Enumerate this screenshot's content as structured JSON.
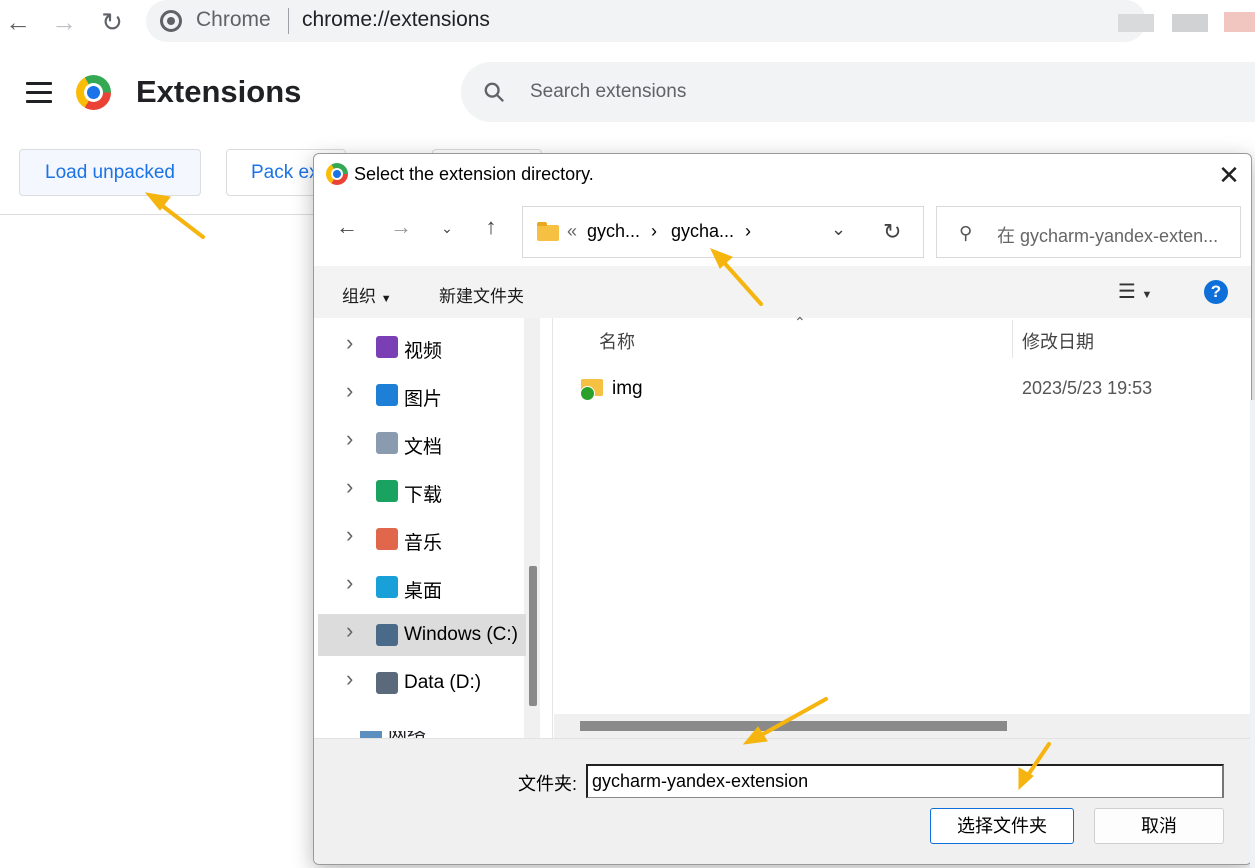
{
  "browser": {
    "site_label": "Chrome",
    "url": "chrome://extensions"
  },
  "page": {
    "title": "Extensions",
    "search_placeholder": "Search extensions",
    "load_unpacked": "Load unpacked",
    "pack_extension": "Pack ex"
  },
  "dialog": {
    "title": "Select the extension directory.",
    "breadcrumb": [
      "gych...",
      "gycha..."
    ],
    "search_placeholder": "在 gycharm-yandex-exten...",
    "toolbar": {
      "organize": "组织",
      "new_folder": "新建文件夹"
    },
    "nav_items": [
      {
        "label": "视频",
        "icon": "video-icon",
        "color": "#7b3fb5"
      },
      {
        "label": "图片",
        "icon": "pictures-icon",
        "color": "#1e7fd6"
      },
      {
        "label": "文档",
        "icon": "documents-icon",
        "color": "#8a9bb0"
      },
      {
        "label": "下载",
        "icon": "downloads-icon",
        "color": "#1aa260"
      },
      {
        "label": "音乐",
        "icon": "music-icon",
        "color": "#e0664c"
      },
      {
        "label": "桌面",
        "icon": "desktop-icon",
        "color": "#1aa0d8"
      },
      {
        "label": "Windows (C:)",
        "icon": "drive-c-icon",
        "color": "#4a6a8a",
        "selected": true
      },
      {
        "label": "Data (D:)",
        "icon": "drive-d-icon",
        "color": "#5a6a7a"
      }
    ],
    "columns": {
      "name": "名称",
      "date": "修改日期"
    },
    "files": [
      {
        "name": "img",
        "date": "2023/5/23 19:53"
      }
    ],
    "folder_label": "文件夹:",
    "folder_value": "gycharm-yandex-extension",
    "select_button": "选择文件夹",
    "cancel_button": "取消",
    "network_partial": "网络"
  },
  "colors": {
    "accent": "#1a73e8",
    "arrow": "#f6b40e",
    "dialog_accent": "#0f6fd8"
  }
}
